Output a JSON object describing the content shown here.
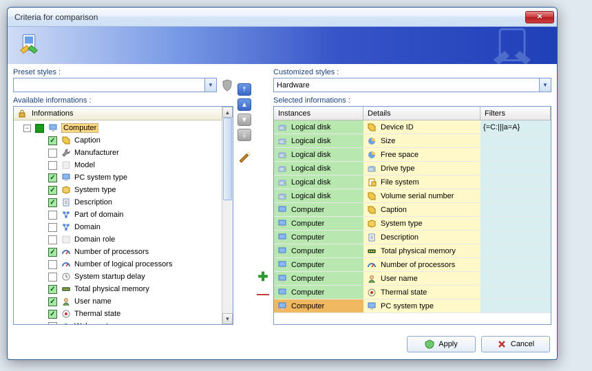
{
  "window": {
    "title": "Criteria for comparison"
  },
  "preset": {
    "label": "Preset styles :",
    "value": ""
  },
  "customized": {
    "label": "Customized styles :",
    "value": "Hardware"
  },
  "available": {
    "label": "Available informations :"
  },
  "selected": {
    "label": "Selected informations :"
  },
  "tree": {
    "header": "Informations",
    "root": {
      "label": "Computer",
      "state": "filled"
    },
    "items": [
      {
        "label": "Caption",
        "checked": true,
        "icon": "tag"
      },
      {
        "label": "Manufacturer",
        "checked": false,
        "icon": "wrench"
      },
      {
        "label": "Model",
        "checked": false,
        "icon": "blank"
      },
      {
        "label": "PC system type",
        "checked": true,
        "icon": "pc"
      },
      {
        "label": "System type",
        "checked": true,
        "icon": "box"
      },
      {
        "label": "Description",
        "checked": true,
        "icon": "doc"
      },
      {
        "label": "Part of domain",
        "checked": false,
        "icon": "net"
      },
      {
        "label": "Domain",
        "checked": false,
        "icon": "net"
      },
      {
        "label": "Domain role",
        "checked": false,
        "icon": "blank"
      },
      {
        "label": "Number of processors",
        "checked": true,
        "icon": "gauge"
      },
      {
        "label": "Number of logical processors",
        "checked": false,
        "icon": "gauge"
      },
      {
        "label": "System startup delay",
        "checked": false,
        "icon": "clock"
      },
      {
        "label": "Total physical memory",
        "checked": true,
        "icon": "mem"
      },
      {
        "label": "User name",
        "checked": true,
        "icon": "user"
      },
      {
        "label": "Thermal state",
        "checked": true,
        "icon": "therm"
      },
      {
        "label": "Wake up type",
        "checked": false,
        "icon": "cycle"
      }
    ]
  },
  "grid": {
    "headers": {
      "c1": "Instances",
      "c2": "Details",
      "c3": "Filters"
    },
    "rows": [
      {
        "instance": "Logical disk",
        "detail": "Device ID",
        "filter": "{=C:|||a=A}",
        "i_icon": "disk",
        "d_icon": "tag"
      },
      {
        "instance": "Logical disk",
        "detail": "Size",
        "filter": "",
        "i_icon": "disk",
        "d_icon": "pie"
      },
      {
        "instance": "Logical disk",
        "detail": "Free space",
        "filter": "",
        "i_icon": "disk",
        "d_icon": "pie"
      },
      {
        "instance": "Logical disk",
        "detail": "Drive type",
        "filter": "",
        "i_icon": "disk",
        "d_icon": "disk"
      },
      {
        "instance": "Logical disk",
        "detail": "File system",
        "filter": "",
        "i_icon": "disk",
        "d_icon": "file"
      },
      {
        "instance": "Logical disk",
        "detail": "Volume serial number",
        "filter": "",
        "i_icon": "disk",
        "d_icon": "tag"
      },
      {
        "instance": "Computer",
        "detail": "Caption",
        "filter": "",
        "i_icon": "pc",
        "d_icon": "tag"
      },
      {
        "instance": "Computer",
        "detail": "System type",
        "filter": "",
        "i_icon": "pc",
        "d_icon": "box"
      },
      {
        "instance": "Computer",
        "detail": "Description",
        "filter": "",
        "i_icon": "pc",
        "d_icon": "doc"
      },
      {
        "instance": "Computer",
        "detail": "Total physical memory",
        "filter": "",
        "i_icon": "pc",
        "d_icon": "mem"
      },
      {
        "instance": "Computer",
        "detail": "Number of processors",
        "filter": "",
        "i_icon": "pc",
        "d_icon": "gauge"
      },
      {
        "instance": "Computer",
        "detail": "User name",
        "filter": "",
        "i_icon": "pc",
        "d_icon": "user"
      },
      {
        "instance": "Computer",
        "detail": "Thermal state",
        "filter": "",
        "i_icon": "pc",
        "d_icon": "therm"
      },
      {
        "instance": "Computer",
        "detail": "PC system type",
        "filter": "",
        "i_icon": "pc",
        "d_icon": "pc",
        "selected": true
      }
    ]
  },
  "buttons": {
    "apply": "Apply",
    "cancel": "Cancel"
  }
}
